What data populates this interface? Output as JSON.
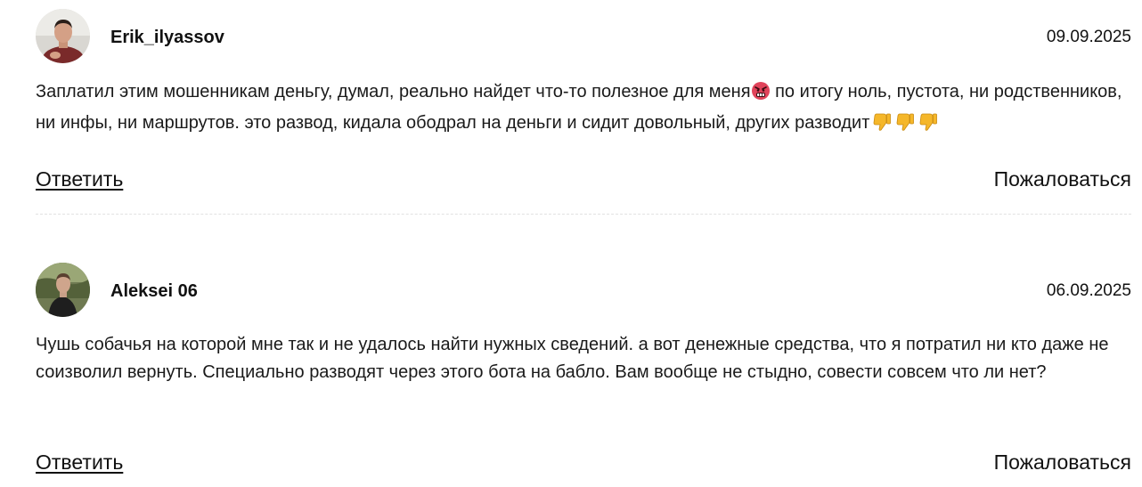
{
  "comments": [
    {
      "author": "Erik_ilyassov",
      "date": "09.09.2025",
      "text_part1": "Заплатил этим мошенникам деньгу, думал, реально найдет что-то полезное для меня",
      "text_part2": " по итогу ноль, пустота, ни родственников, ни инфы, ни маршрутов. это развод, кидала ободрал на деньги и сидит довольный, других разводит",
      "emojis": [
        "angry-face-icon",
        "thumbs-down-icon",
        "thumbs-down-icon",
        "thumbs-down-icon"
      ],
      "reply_label": "Ответить",
      "report_label": "Пожаловаться"
    },
    {
      "author": "Aleksei 06",
      "date": "06.09.2025",
      "text": "Чушь собачья на которой мне так и не удалось найти нужных сведений. а вот денежные средства, что я потратил ни кто даже не соизволил вернуть. Специально разводят через этого бота на бабло. Вам вообще не стыдно, совести совсем что ли нет?",
      "reply_label": "Ответить",
      "report_label": "Пожаловаться"
    }
  ],
  "colors": {
    "text": "#1a1a1a",
    "divider": "#e2e2e2",
    "angry_emoji": "#e0435a",
    "thumbs_emoji": "#f5b72a"
  }
}
